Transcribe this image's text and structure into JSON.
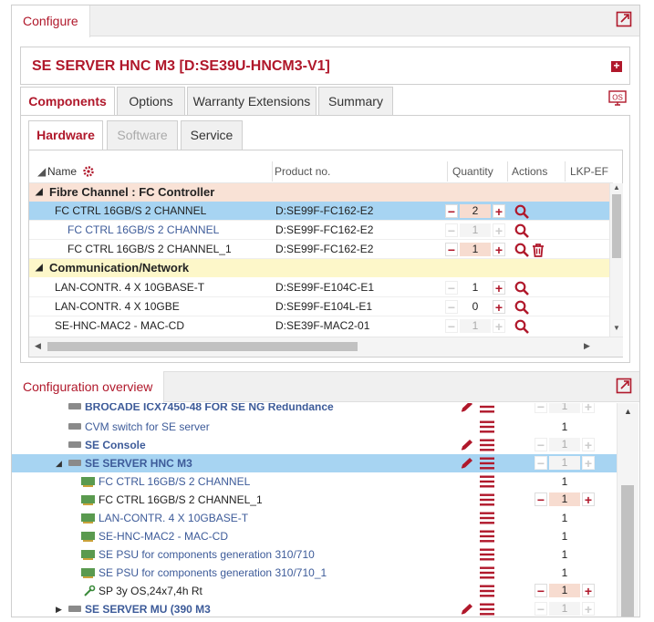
{
  "configure": {
    "tab_label": "Configure",
    "title": "SE SERVER HNC M3 [D:SE39U-HNCM3-V1]",
    "tabs": [
      "Components",
      "Options",
      "Warranty Extensions",
      "Summary"
    ],
    "subtabs": [
      "Hardware",
      "Software",
      "Service"
    ],
    "os_icon_label": "OS",
    "columns": {
      "name": "Name",
      "product": "Product no.",
      "quantity": "Quantity",
      "actions": "Actions",
      "lkp": "LKP-EF"
    },
    "groups": [
      {
        "title": "Fibre Channel : FC Controller",
        "rows": [
          {
            "name": "FC CTRL 16GB/S 2 CHANNEL",
            "product": "D:SE99F-FC162-E2",
            "qty": "2",
            "selected": true,
            "editable": true,
            "delete": false,
            "indent": 1,
            "link": false
          },
          {
            "name": "FC CTRL 16GB/S 2 CHANNEL",
            "product": "D:SE99F-FC162-E2",
            "qty": "1",
            "selected": false,
            "editable": false,
            "delete": false,
            "indent": 2,
            "link": true
          },
          {
            "name": "FC CTRL 16GB/S 2 CHANNEL_1",
            "product": "D:SE99F-FC162-E2",
            "qty": "1",
            "selected": false,
            "editable": true,
            "delete": true,
            "indent": 2,
            "link": false
          }
        ]
      },
      {
        "title": "Communication/Network",
        "rows": [
          {
            "name": "LAN-CONTR. 4 X 10GBASE-T",
            "product": "D:SE99F-E104C-E1",
            "qty": "1",
            "selected": false,
            "editable": "plus",
            "delete": false,
            "indent": 1,
            "link": false
          },
          {
            "name": "LAN-CONTR. 4 X 10GBE",
            "product": "D:SE99F-E104L-E1",
            "qty": "0",
            "selected": false,
            "editable": "plus",
            "delete": false,
            "indent": 1,
            "link": false
          },
          {
            "name": "SE-HNC-MAC2 - MAC-CD",
            "product": "D:SE39F-MAC2-01",
            "qty": "1",
            "selected": false,
            "editable": false,
            "delete": false,
            "indent": 1,
            "link": false
          }
        ]
      }
    ]
  },
  "overview": {
    "tab_label": "Configuration overview",
    "rows": [
      {
        "label": "BROCADE ICX7450-48 FOR SE NG Redundance",
        "icon": "device",
        "expander": "",
        "level": 0,
        "bold": true,
        "qty": "1",
        "qty_mode": "disabled",
        "pencil": true,
        "selected": false,
        "clipped": true
      },
      {
        "label": "CVM switch for SE server",
        "icon": "device",
        "expander": "",
        "level": 0,
        "bold": false,
        "qty": "1",
        "qty_mode": "text",
        "pencil": false,
        "selected": false
      },
      {
        "label": "SE Console",
        "icon": "device",
        "expander": "",
        "level": 0,
        "bold": true,
        "qty": "1",
        "qty_mode": "disabled",
        "pencil": true,
        "selected": false
      },
      {
        "label": "SE SERVER HNC M3",
        "icon": "device",
        "expander": "◢",
        "level": 0,
        "bold": true,
        "qty": "1",
        "qty_mode": "disabled",
        "pencil": true,
        "selected": true
      },
      {
        "label": "FC CTRL 16GB/S 2 CHANNEL",
        "icon": "card",
        "expander": "",
        "level": 1,
        "bold": false,
        "qty": "1",
        "qty_mode": "text",
        "pencil": false,
        "selected": false
      },
      {
        "label": "FC CTRL 16GB/S 2 CHANNEL_1",
        "icon": "card",
        "expander": "",
        "level": 1,
        "bold": false,
        "dark": true,
        "qty": "1",
        "qty_mode": "edit",
        "pencil": false,
        "selected": false
      },
      {
        "label": "LAN-CONTR. 4 X 10GBASE-T",
        "icon": "card",
        "expander": "",
        "level": 1,
        "bold": false,
        "qty": "1",
        "qty_mode": "text",
        "pencil": false,
        "selected": false
      },
      {
        "label": "SE-HNC-MAC2 - MAC-CD",
        "icon": "card",
        "expander": "",
        "level": 1,
        "bold": false,
        "qty": "1",
        "qty_mode": "text",
        "pencil": false,
        "selected": false
      },
      {
        "label": "SE PSU for components generation 310/710",
        "icon": "card",
        "expander": "",
        "level": 1,
        "bold": false,
        "qty": "1",
        "qty_mode": "text",
        "pencil": false,
        "selected": false
      },
      {
        "label": "SE PSU for components generation 310/710_1",
        "icon": "card",
        "expander": "",
        "level": 1,
        "bold": false,
        "qty": "1",
        "qty_mode": "text",
        "pencil": false,
        "selected": false
      },
      {
        "label": "SP 3y OS,24x7,4h Rt",
        "icon": "wrench",
        "expander": "",
        "level": 1,
        "bold": false,
        "dark": true,
        "qty": "1",
        "qty_mode": "edit",
        "pencil": false,
        "selected": false
      },
      {
        "label": "SE SERVER MU (390 M3",
        "icon": "device",
        "expander": "▶",
        "level": 0,
        "bold": true,
        "qty": "1",
        "qty_mode": "disabled",
        "pencil": true,
        "selected": false,
        "clipped": true
      }
    ]
  },
  "colors": {
    "brand_red": "#b0182b",
    "selection_blue": "#a7d4f2",
    "group_salmon": "#f9e2d6",
    "group_yellow": "#fdf7c9"
  }
}
